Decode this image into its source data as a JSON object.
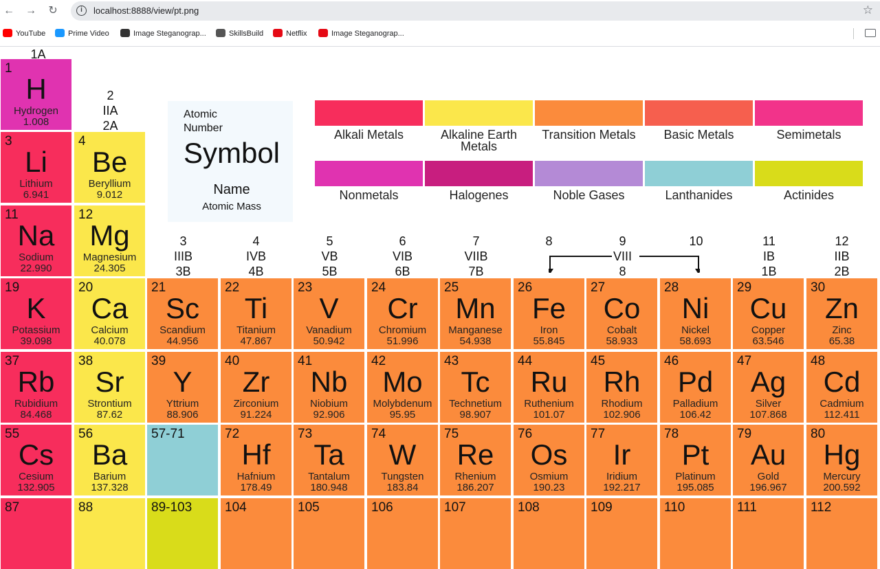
{
  "browser": {
    "back_icon": "←",
    "forward_icon": "→",
    "reload_icon": "↻",
    "url": "localhost:8888/view/pt.png",
    "star_icon": "☆",
    "bookmarks": [
      {
        "label": "YouTube",
        "color": "#ff0000"
      },
      {
        "label": "Prime Video",
        "color": "#1a98ff"
      },
      {
        "label": "Image Steganograp...",
        "color": "#333333"
      },
      {
        "label": "SkillsBuild",
        "color": "#555555"
      },
      {
        "label": "Netflix",
        "color": "#e50914"
      },
      {
        "label": "Image Steganograp...",
        "color": "#e50914"
      }
    ]
  },
  "key": {
    "atomic_number_label": "Atomic Number",
    "symbol_label": "Symbol",
    "name_label": "Name",
    "atomic_mass_label": "Atomic Mass"
  },
  "legend": [
    {
      "label": "Alkali Metals",
      "color": "#f72d5c"
    },
    {
      "label": "Alkaline Earth Metals",
      "color": "#fbe74b"
    },
    {
      "label": "Transition Metals",
      "color": "#fb8b3c"
    },
    {
      "label": "Basic Metals",
      "color": "#f65f4e"
    },
    {
      "label": "Semimetals",
      "color": "#f2338a"
    },
    {
      "label": "Nonmetals",
      "color": "#e033b0"
    },
    {
      "label": "Halogenes",
      "color": "#c81e7f"
    },
    {
      "label": "Noble Gases",
      "color": "#b48ad6"
    },
    {
      "label": "Lanthanides",
      "color": "#8fcfd6"
    },
    {
      "label": "Actinides",
      "color": "#d9dc1a"
    }
  ],
  "groups": {
    "g1": "1A",
    "g2": [
      "2",
      "IIA",
      "2A"
    ],
    "g3": [
      "3",
      "IIIB",
      "3B"
    ],
    "g4": [
      "4",
      "IVB",
      "4B"
    ],
    "g5": [
      "5",
      "VB",
      "5B"
    ],
    "g6": [
      "6",
      "VIB",
      "6B"
    ],
    "g7": [
      "7",
      "VIIB",
      "7B"
    ],
    "g8": "8",
    "g9": [
      "9",
      "VIII",
      "8"
    ],
    "g10": "10",
    "g11": [
      "11",
      "IB",
      "1B"
    ],
    "g12": [
      "12",
      "IIB",
      "2B"
    ]
  },
  "colors": {
    "alkali": "#f72d5c",
    "alkaline": "#fbe74b",
    "transition": "#fb8b3c",
    "nonmetal": "#e033b0",
    "lanthanide": "#8fcfd6",
    "actinide": "#d9dc1a"
  },
  "elements": [
    {
      "num": "1",
      "sym": "H",
      "name": "Hydrogen",
      "mass": "1.008"
    },
    {
      "num": "3",
      "sym": "Li",
      "name": "Lithium",
      "mass": "6.941"
    },
    {
      "num": "4",
      "sym": "Be",
      "name": "Beryllium",
      "mass": "9.012"
    },
    {
      "num": "11",
      "sym": "Na",
      "name": "Sodium",
      "mass": "22.990"
    },
    {
      "num": "12",
      "sym": "Mg",
      "name": "Magnesium",
      "mass": "24.305"
    },
    {
      "num": "19",
      "sym": "K",
      "name": "Potassium",
      "mass": "39.098"
    },
    {
      "num": "20",
      "sym": "Ca",
      "name": "Calcium",
      "mass": "40.078"
    },
    {
      "num": "21",
      "sym": "Sc",
      "name": "Scandium",
      "mass": "44.956"
    },
    {
      "num": "22",
      "sym": "Ti",
      "name": "Titanium",
      "mass": "47.867"
    },
    {
      "num": "23",
      "sym": "V",
      "name": "Vanadium",
      "mass": "50.942"
    },
    {
      "num": "24",
      "sym": "Cr",
      "name": "Chromium",
      "mass": "51.996"
    },
    {
      "num": "25",
      "sym": "Mn",
      "name": "Manganese",
      "mass": "54.938"
    },
    {
      "num": "26",
      "sym": "Fe",
      "name": "Iron",
      "mass": "55.845"
    },
    {
      "num": "27",
      "sym": "Co",
      "name": "Cobalt",
      "mass": "58.933"
    },
    {
      "num": "28",
      "sym": "Ni",
      "name": "Nickel",
      "mass": "58.693"
    },
    {
      "num": "29",
      "sym": "Cu",
      "name": "Copper",
      "mass": "63.546"
    },
    {
      "num": "30",
      "sym": "Zn",
      "name": "Zinc",
      "mass": "65.38"
    },
    {
      "num": "37",
      "sym": "Rb",
      "name": "Rubidium",
      "mass": "84.468"
    },
    {
      "num": "38",
      "sym": "Sr",
      "name": "Strontium",
      "mass": "87.62"
    },
    {
      "num": "39",
      "sym": "Y",
      "name": "Yttrium",
      "mass": "88.906"
    },
    {
      "num": "40",
      "sym": "Zr",
      "name": "Zirconium",
      "mass": "91.224"
    },
    {
      "num": "41",
      "sym": "Nb",
      "name": "Niobium",
      "mass": "92.906"
    },
    {
      "num": "42",
      "sym": "Mo",
      "name": "Molybdenum",
      "mass": "95.95"
    },
    {
      "num": "43",
      "sym": "Tc",
      "name": "Technetium",
      "mass": "98.907"
    },
    {
      "num": "44",
      "sym": "Ru",
      "name": "Ruthenium",
      "mass": "101.07"
    },
    {
      "num": "45",
      "sym": "Rh",
      "name": "Rhodium",
      "mass": "102.906"
    },
    {
      "num": "46",
      "sym": "Pd",
      "name": "Palladium",
      "mass": "106.42"
    },
    {
      "num": "47",
      "sym": "Ag",
      "name": "Silver",
      "mass": "107.868"
    },
    {
      "num": "48",
      "sym": "Cd",
      "name": "Cadmium",
      "mass": "112.411"
    },
    {
      "num": "55",
      "sym": "Cs",
      "name": "Cesium",
      "mass": "132.905"
    },
    {
      "num": "56",
      "sym": "Ba",
      "name": "Barium",
      "mass": "137.328"
    },
    {
      "num": "57-71",
      "sym": "",
      "name": "",
      "mass": ""
    },
    {
      "num": "72",
      "sym": "Hf",
      "name": "Hafnium",
      "mass": "178.49"
    },
    {
      "num": "73",
      "sym": "Ta",
      "name": "Tantalum",
      "mass": "180.948"
    },
    {
      "num": "74",
      "sym": "W",
      "name": "Tungsten",
      "mass": "183.84"
    },
    {
      "num": "75",
      "sym": "Re",
      "name": "Rhenium",
      "mass": "186.207"
    },
    {
      "num": "76",
      "sym": "Os",
      "name": "Osmium",
      "mass": "190.23"
    },
    {
      "num": "77",
      "sym": "Ir",
      "name": "Iridium",
      "mass": "192.217"
    },
    {
      "num": "78",
      "sym": "Pt",
      "name": "Platinum",
      "mass": "195.085"
    },
    {
      "num": "79",
      "sym": "Au",
      "name": "Gold",
      "mass": "196.967"
    },
    {
      "num": "80",
      "sym": "Hg",
      "name": "Mercury",
      "mass": "200.592"
    },
    {
      "num": "87",
      "sym": "",
      "name": "",
      "mass": ""
    },
    {
      "num": "88",
      "sym": "",
      "name": "",
      "mass": ""
    },
    {
      "num": "89-103",
      "sym": "",
      "name": "",
      "mass": ""
    },
    {
      "num": "104",
      "sym": "",
      "name": "",
      "mass": ""
    },
    {
      "num": "105",
      "sym": "",
      "name": "",
      "mass": ""
    },
    {
      "num": "106",
      "sym": "",
      "name": "",
      "mass": ""
    },
    {
      "num": "107",
      "sym": "",
      "name": "",
      "mass": ""
    },
    {
      "num": "108",
      "sym": "",
      "name": "",
      "mass": ""
    },
    {
      "num": "109",
      "sym": "",
      "name": "",
      "mass": ""
    },
    {
      "num": "110",
      "sym": "",
      "name": "",
      "mass": ""
    },
    {
      "num": "111",
      "sym": "",
      "name": "",
      "mass": ""
    },
    {
      "num": "112",
      "sym": "",
      "name": "",
      "mass": ""
    }
  ]
}
